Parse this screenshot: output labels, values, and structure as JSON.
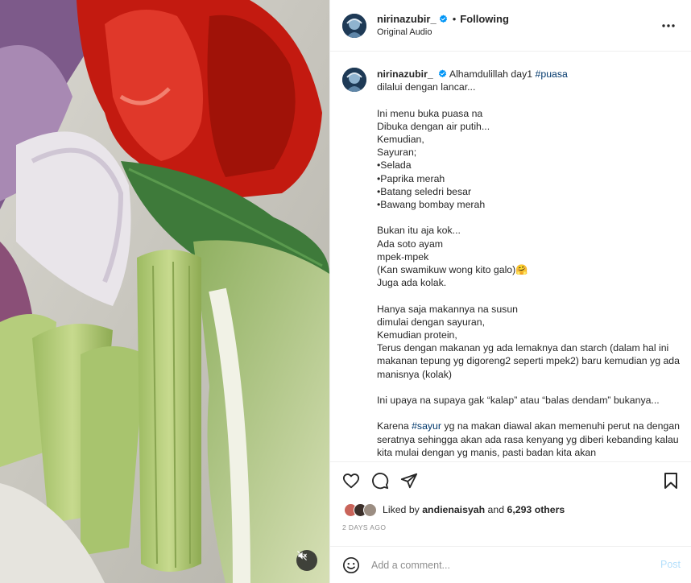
{
  "post": {
    "username": "nirinazubir_",
    "follow_status": "Following",
    "separator": "•",
    "audio_label": "Original Audio"
  },
  "caption": {
    "username": "nirinazubir_",
    "first_text": "Alhamdulillah day1 ",
    "first_hashtag": "#puasa",
    "body": "dilalui dengan lancar...\n\nIni menu buka puasa na\nDibuka dengan air putih...\nKemudian,\nSayuran;\n•Selada\n•Paprika merah\n•Batang seledri besar\n•Bawang bombay merah\n\nBukan itu aja kok...\nAda soto ayam\nmpek-mpek\n(Kan swamikuw wong kito galo)🤗\nJuga ada kolak.\n\nHanya saja makannya na susun\ndimulai dengan sayuran,\nKemudian protein,\nTerus dengan makanan yg ada lemaknya dan starch (dalam hal ini makanan tepung yg digoreng2 seperti mpek2) baru kemudian yg ada manisnya (kolak)\n\nIni upaya na supaya gak “kalap” atau “balas dendam” bukanya...\n\n",
    "last_hashtag": "#sayur",
    "last_prefix": "Karena ",
    "last_text": " yg na makan diawal akan memenuhi perut na dengan seratnya sehingga akan ada rasa kenyang yg diberi kebanding kalau kita mulai dengan yg manis, pasti badan kita akan"
  },
  "likes": {
    "prefix": "Liked by ",
    "user": "andienaisyah",
    "middle": " and ",
    "count": "6,293 others"
  },
  "date": "2 DAYS AGO",
  "comment": {
    "placeholder": "Add a comment...",
    "post_label": "Post"
  },
  "icons": [
    "verified-badge-icon",
    "more-options-icon",
    "heart-icon",
    "comment-icon",
    "share-icon",
    "bookmark-icon",
    "emoji-icon",
    "mute-icon"
  ],
  "colors": {
    "verified": "#0095f6",
    "hashtag": "#00376b",
    "muted_text": "#8e8e8e",
    "post_disabled": "#b2dffc"
  }
}
